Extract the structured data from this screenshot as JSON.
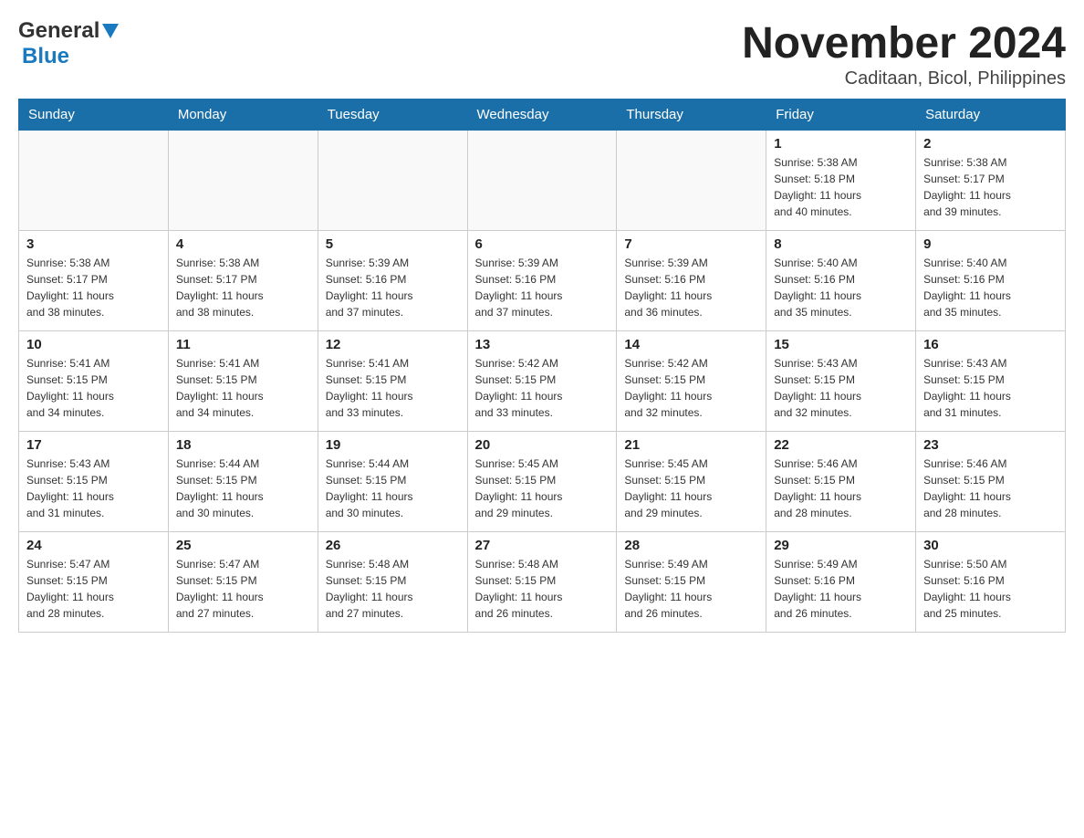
{
  "header": {
    "logo": {
      "general": "General",
      "blue": "Blue"
    },
    "title": "November 2024",
    "subtitle": "Caditaan, Bicol, Philippines"
  },
  "calendar": {
    "days_of_week": [
      "Sunday",
      "Monday",
      "Tuesday",
      "Wednesday",
      "Thursday",
      "Friday",
      "Saturday"
    ],
    "weeks": [
      [
        {
          "day": "",
          "info": ""
        },
        {
          "day": "",
          "info": ""
        },
        {
          "day": "",
          "info": ""
        },
        {
          "day": "",
          "info": ""
        },
        {
          "day": "",
          "info": ""
        },
        {
          "day": "1",
          "info": "Sunrise: 5:38 AM\nSunset: 5:18 PM\nDaylight: 11 hours\nand 40 minutes."
        },
        {
          "day": "2",
          "info": "Sunrise: 5:38 AM\nSunset: 5:17 PM\nDaylight: 11 hours\nand 39 minutes."
        }
      ],
      [
        {
          "day": "3",
          "info": "Sunrise: 5:38 AM\nSunset: 5:17 PM\nDaylight: 11 hours\nand 38 minutes."
        },
        {
          "day": "4",
          "info": "Sunrise: 5:38 AM\nSunset: 5:17 PM\nDaylight: 11 hours\nand 38 minutes."
        },
        {
          "day": "5",
          "info": "Sunrise: 5:39 AM\nSunset: 5:16 PM\nDaylight: 11 hours\nand 37 minutes."
        },
        {
          "day": "6",
          "info": "Sunrise: 5:39 AM\nSunset: 5:16 PM\nDaylight: 11 hours\nand 37 minutes."
        },
        {
          "day": "7",
          "info": "Sunrise: 5:39 AM\nSunset: 5:16 PM\nDaylight: 11 hours\nand 36 minutes."
        },
        {
          "day": "8",
          "info": "Sunrise: 5:40 AM\nSunset: 5:16 PM\nDaylight: 11 hours\nand 35 minutes."
        },
        {
          "day": "9",
          "info": "Sunrise: 5:40 AM\nSunset: 5:16 PM\nDaylight: 11 hours\nand 35 minutes."
        }
      ],
      [
        {
          "day": "10",
          "info": "Sunrise: 5:41 AM\nSunset: 5:15 PM\nDaylight: 11 hours\nand 34 minutes."
        },
        {
          "day": "11",
          "info": "Sunrise: 5:41 AM\nSunset: 5:15 PM\nDaylight: 11 hours\nand 34 minutes."
        },
        {
          "day": "12",
          "info": "Sunrise: 5:41 AM\nSunset: 5:15 PM\nDaylight: 11 hours\nand 33 minutes."
        },
        {
          "day": "13",
          "info": "Sunrise: 5:42 AM\nSunset: 5:15 PM\nDaylight: 11 hours\nand 33 minutes."
        },
        {
          "day": "14",
          "info": "Sunrise: 5:42 AM\nSunset: 5:15 PM\nDaylight: 11 hours\nand 32 minutes."
        },
        {
          "day": "15",
          "info": "Sunrise: 5:43 AM\nSunset: 5:15 PM\nDaylight: 11 hours\nand 32 minutes."
        },
        {
          "day": "16",
          "info": "Sunrise: 5:43 AM\nSunset: 5:15 PM\nDaylight: 11 hours\nand 31 minutes."
        }
      ],
      [
        {
          "day": "17",
          "info": "Sunrise: 5:43 AM\nSunset: 5:15 PM\nDaylight: 11 hours\nand 31 minutes."
        },
        {
          "day": "18",
          "info": "Sunrise: 5:44 AM\nSunset: 5:15 PM\nDaylight: 11 hours\nand 30 minutes."
        },
        {
          "day": "19",
          "info": "Sunrise: 5:44 AM\nSunset: 5:15 PM\nDaylight: 11 hours\nand 30 minutes."
        },
        {
          "day": "20",
          "info": "Sunrise: 5:45 AM\nSunset: 5:15 PM\nDaylight: 11 hours\nand 29 minutes."
        },
        {
          "day": "21",
          "info": "Sunrise: 5:45 AM\nSunset: 5:15 PM\nDaylight: 11 hours\nand 29 minutes."
        },
        {
          "day": "22",
          "info": "Sunrise: 5:46 AM\nSunset: 5:15 PM\nDaylight: 11 hours\nand 28 minutes."
        },
        {
          "day": "23",
          "info": "Sunrise: 5:46 AM\nSunset: 5:15 PM\nDaylight: 11 hours\nand 28 minutes."
        }
      ],
      [
        {
          "day": "24",
          "info": "Sunrise: 5:47 AM\nSunset: 5:15 PM\nDaylight: 11 hours\nand 28 minutes."
        },
        {
          "day": "25",
          "info": "Sunrise: 5:47 AM\nSunset: 5:15 PM\nDaylight: 11 hours\nand 27 minutes."
        },
        {
          "day": "26",
          "info": "Sunrise: 5:48 AM\nSunset: 5:15 PM\nDaylight: 11 hours\nand 27 minutes."
        },
        {
          "day": "27",
          "info": "Sunrise: 5:48 AM\nSunset: 5:15 PM\nDaylight: 11 hours\nand 26 minutes."
        },
        {
          "day": "28",
          "info": "Sunrise: 5:49 AM\nSunset: 5:15 PM\nDaylight: 11 hours\nand 26 minutes."
        },
        {
          "day": "29",
          "info": "Sunrise: 5:49 AM\nSunset: 5:16 PM\nDaylight: 11 hours\nand 26 minutes."
        },
        {
          "day": "30",
          "info": "Sunrise: 5:50 AM\nSunset: 5:16 PM\nDaylight: 11 hours\nand 25 minutes."
        }
      ]
    ]
  }
}
